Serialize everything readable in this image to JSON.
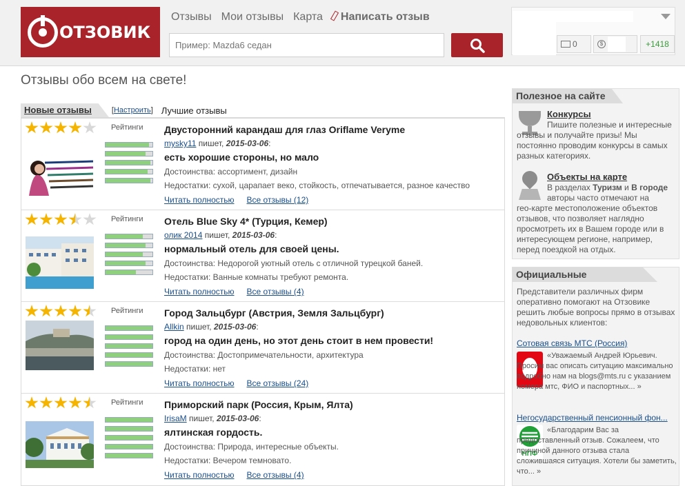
{
  "header": {
    "logo_text": "ОТЗОВИК",
    "nav": [
      "Отзывы",
      "Мои отзывы",
      "Карта"
    ],
    "write_review": "Написать отзыв",
    "search_placeholder": "Пример: Mazda6 седан",
    "mail_count": "0",
    "rating_count": "+1418"
  },
  "tagline": "Отзывы обо всем на свете!",
  "tabs": {
    "new": "Новые отзывы",
    "configure": "Настроить",
    "best": "Лучшие отзывы"
  },
  "ratings_label": "Рейтинги",
  "pros_label": "Достоинства:",
  "cons_label": "Недостатки:",
  "read_more": "Читать полностью",
  "reviews": [
    {
      "stars": 4,
      "title": "Двусторонний карандаш для глаз Oriflame Veryme",
      "author": "mysky11",
      "writes": " пишет, ",
      "date": "2015-03-06",
      "headline": "есть хорошие стороны, но мало",
      "pros": "ассортимент, дизайн",
      "cons": "сухой, царапает веко, стойкость, отпечатывается, разное качество",
      "all_reviews": "Все отзывы (12)",
      "bars": [
        0.92,
        0.85,
        0.95,
        0.9,
        0.95
      ]
    },
    {
      "stars": 3.5,
      "title": "Отель Blue Sky 4* (Турция, Кемер)",
      "author": "олик 2014",
      "writes": " пишет, ",
      "date": "2015-03-06",
      "headline": "нормальный отель для своей цены.",
      "pros": "Недорогой уютный отель с отличной турецкой баней.",
      "cons": "Ванные комнаты требуют ремонта.",
      "all_reviews": "Все отзывы (4)",
      "bars": [
        0.8,
        0.85,
        0.8,
        0.85,
        0.65
      ]
    },
    {
      "stars": 4.5,
      "title": "Город Зальцбург (Австрия, Земля Зальцбург)",
      "author": "Allkin",
      "writes": " пишет, ",
      "date": "2015-03-06",
      "headline": "город на один день, но этот день стоит в нем провести!",
      "pros": "Достопримечательности, архитектура",
      "cons": "нет",
      "all_reviews": "Все отзывы (24)",
      "bars": [
        1.0,
        1.0,
        1.0,
        1.0,
        1.0
      ]
    },
    {
      "stars": 4.5,
      "title": "Приморский парк (Россия, Крым, Ялта)",
      "author": "IrisaM",
      "writes": " пишет, ",
      "date": "2015-03-06",
      "headline": "ялтинская гордость.",
      "pros": "Природа, интересные объекты.",
      "cons": "Вечером темновато.",
      "all_reviews": "Все отзывы (4)",
      "bars": [
        1.0,
        1.0,
        1.0,
        1.0,
        1.0
      ]
    }
  ],
  "sidebar": {
    "useful_title": "Полезное на сайте",
    "contests_head": "Конкурсы",
    "contests_text1": "Пишите полезные и интересные",
    "contests_text2": "отзывы и получайте призы! Мы постоянно проводим конкурсы в самых разных категориях.",
    "map_head": "Объекты на карте",
    "map_text_pre": "В разделах ",
    "map_b1": "Туризм",
    "map_and": " и ",
    "map_b2": "В городе",
    "map_text1": "авторы часто отмечают на",
    "map_text2": "гео-карте местоположение объектов отзывов, что позволяет наглядно просмотреть их в Вашем городе или в интересующем регионе, например, перед поездкой на отдых.",
    "official_title": "Официальные представители",
    "official_text": "Представители различных фирм оперативно помогают на Отзовике решить любые вопросы прямо в отзывах недовольных клиентов:",
    "rep1_link": "Сотовая связь МТС (Россия)",
    "rep1_quote": "«Уважаемый Андрей Юрьевич. Просим вас описать ситуацию максимально подробно нам на blogs@mts.ru с указанием номера мтс, ФИО и паспортных... »",
    "rep2_link": "Негосударственный пенсионный фон...",
    "rep2_logo_text": "НПФ",
    "rep2_quote": "«Благодарим Вас за предоставленный отзыв. Сожалеем, что причиной данного отзыва стала сложившаяся ситуация. Хотели бы заметить, что... »"
  }
}
